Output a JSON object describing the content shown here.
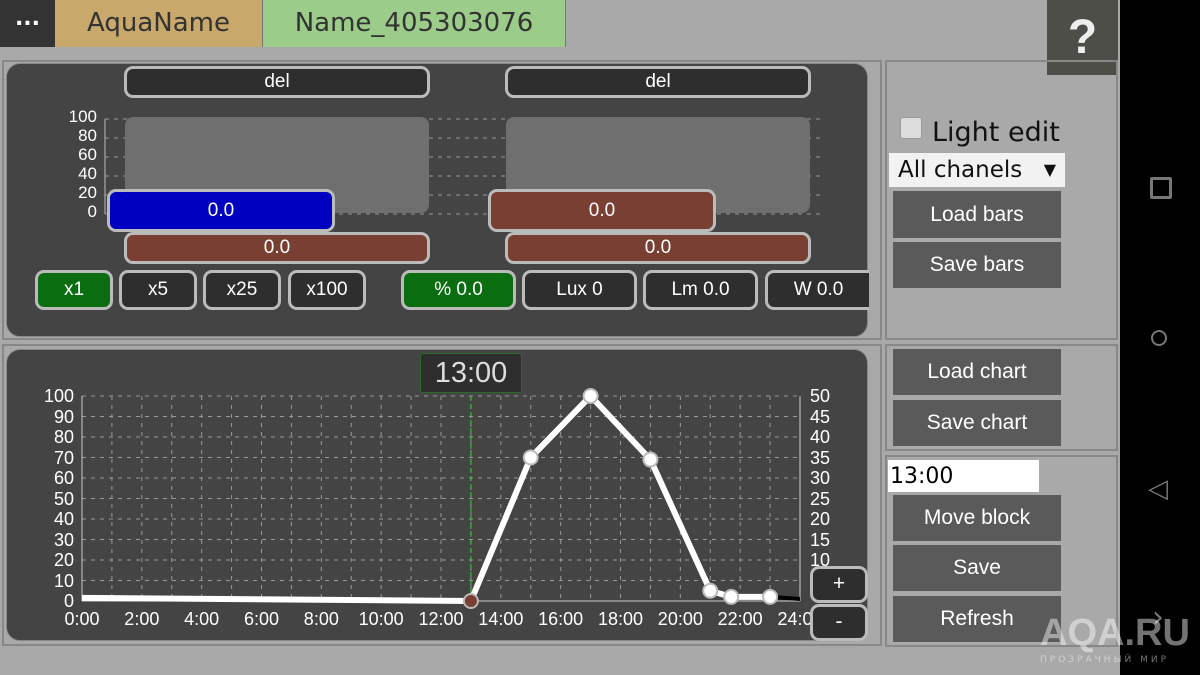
{
  "header": {
    "menu_label": "...",
    "tabs": [
      {
        "label": "AquaName",
        "color": "#c9a86c"
      },
      {
        "label": "Name_405303076",
        "color": "#9ccc8a"
      }
    ],
    "help_label": "?"
  },
  "bars_panel": {
    "y_ticks": [
      "100",
      "80",
      "60",
      "40",
      "20",
      "0"
    ],
    "channels": [
      {
        "del_label": "del",
        "value_label": "0.0",
        "value_color": "#0000c0",
        "bottom_label": "0.0"
      },
      {
        "del_label": "del",
        "value_label": "0.0",
        "value_color": "#7a3f33",
        "bottom_label": "0.0"
      }
    ],
    "scale_buttons": [
      {
        "label": "x1",
        "active": true
      },
      {
        "label": "x5",
        "active": false
      },
      {
        "label": "x25",
        "active": false
      },
      {
        "label": "x100",
        "active": false
      }
    ],
    "unit_buttons": [
      {
        "label": "% 0.0",
        "active": true
      },
      {
        "label": "Lux 0",
        "active": false
      },
      {
        "label": "Lm 0.0",
        "active": false
      },
      {
        "label": "W 0.0",
        "active": false
      }
    ]
  },
  "side_bars": {
    "light_edit_label": "Light edit",
    "light_edit_checked": false,
    "channel_select": "All chanels",
    "load_bars": "Load bars",
    "save_bars": "Save bars"
  },
  "side_chart": {
    "load_chart": "Load chart",
    "save_chart": "Save chart"
  },
  "side_block": {
    "time_input": "13:00",
    "move_block": "Move block",
    "save": "Save",
    "refresh": "Refresh"
  },
  "chart_data": {
    "type": "line",
    "current_time_label": "13:00",
    "current_time": 13,
    "x_ticks": [
      "0:00",
      "2:00",
      "4:00",
      "6:00",
      "8:00",
      "10:00",
      "12:00",
      "14:00",
      "16:00",
      "18:00",
      "20:00",
      "22:00",
      "24:00"
    ],
    "xlim": [
      0,
      24
    ],
    "ylim": [
      0,
      100
    ],
    "y_ticks_left": [
      "100",
      "90",
      "80",
      "70",
      "60",
      "50",
      "40",
      "30",
      "20",
      "10",
      "0"
    ],
    "y_ticks_right": [
      "50",
      "45",
      "40",
      "35",
      "30",
      "25",
      "20",
      "15",
      "10"
    ],
    "grid": true,
    "points": [
      {
        "x": 0,
        "y": 1.5
      },
      {
        "x": 13,
        "y": 0,
        "selected": true
      },
      {
        "x": 15,
        "y": 70
      },
      {
        "x": 17,
        "y": 100
      },
      {
        "x": 19,
        "y": 69
      },
      {
        "x": 21,
        "y": 5
      },
      {
        "x": 21.7,
        "y": 2
      },
      {
        "x": 23,
        "y": 2
      },
      {
        "x": 24,
        "y": 1
      }
    ],
    "zoom_in": "+",
    "zoom_out": "-"
  },
  "watermark": {
    "text": "AQA.RU",
    "subtext": "ПРОЗРАЧНЫЙ МИР"
  }
}
